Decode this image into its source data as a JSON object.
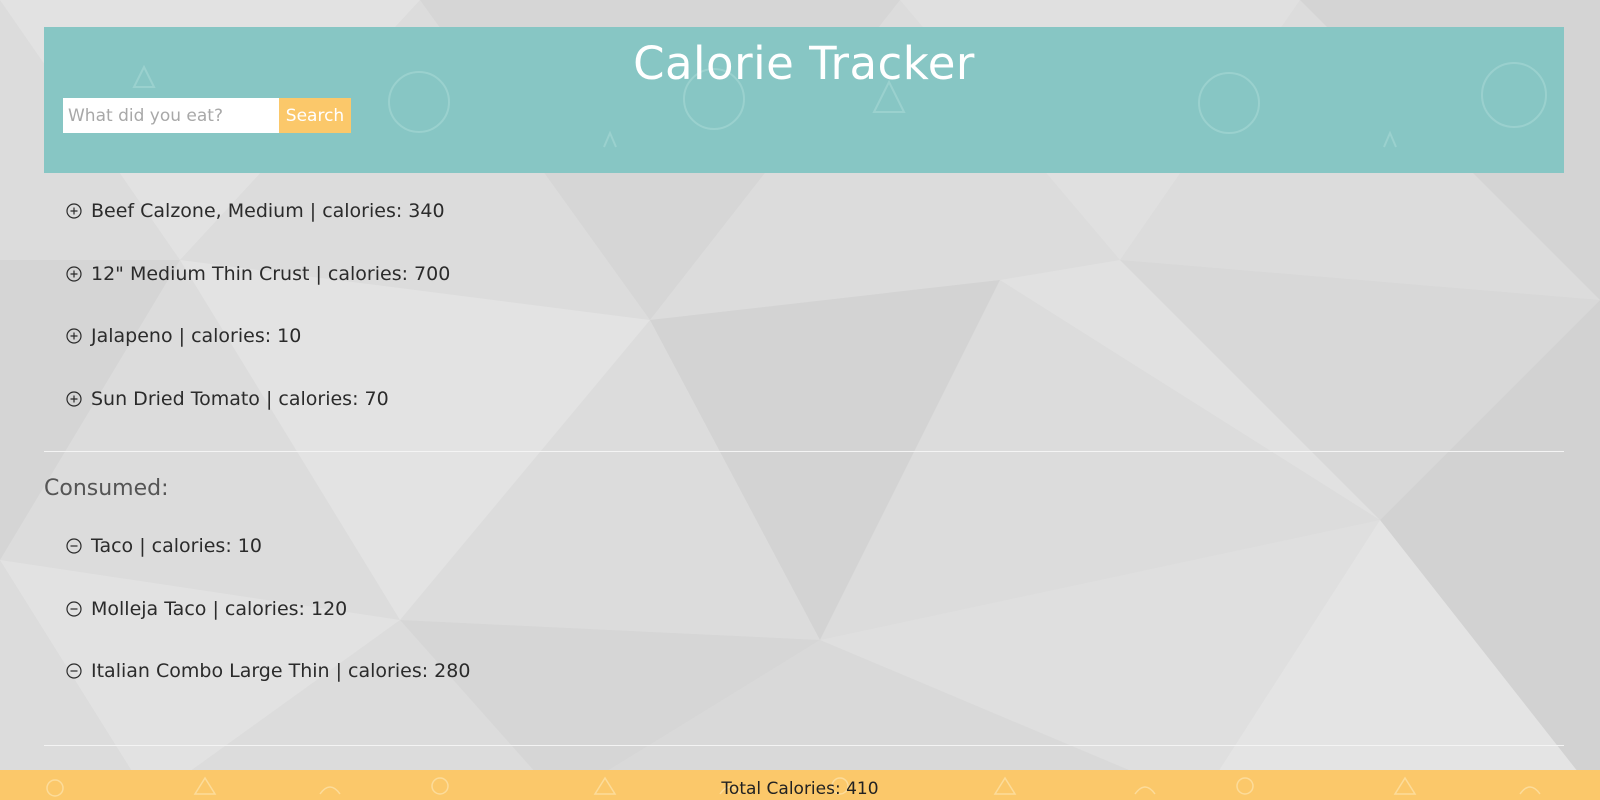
{
  "colors": {
    "header_bg": "#87c6c4",
    "accent": "#fbc86a",
    "page_bg": "#dcdcdc"
  },
  "header": {
    "title": "Calorie Tracker",
    "search_placeholder": "What did you eat?",
    "search_value": "",
    "search_button_label": "Search"
  },
  "results": {
    "items": [
      {
        "label": "Beef Calzone, Medium | calories: 340",
        "icon": "add-circle-icon"
      },
      {
        "label": "12\" Medium Thin Crust | calories: 700",
        "icon": "add-circle-icon"
      },
      {
        "label": "Jalapeno | calories: 10",
        "icon": "add-circle-icon"
      },
      {
        "label": "Sun Dried Tomato | calories: 70",
        "icon": "add-circle-icon"
      }
    ]
  },
  "consumed": {
    "heading": "Consumed:",
    "items": [
      {
        "label": "Taco | calories: 10",
        "icon": "remove-circle-icon"
      },
      {
        "label": "Molleja Taco | calories: 120",
        "icon": "remove-circle-icon"
      },
      {
        "label": "Italian Combo Large Thin | calories: 280",
        "icon": "remove-circle-icon"
      }
    ]
  },
  "footer": {
    "total_text": "Total Calories: 410"
  }
}
